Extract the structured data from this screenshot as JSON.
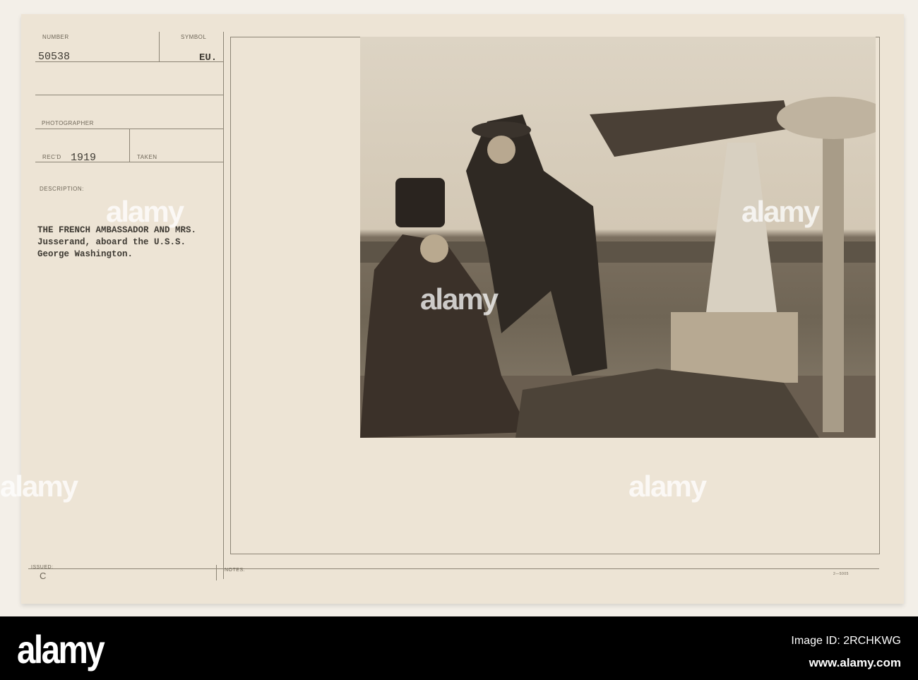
{
  "card": {
    "number_label": "NUMBER",
    "number": "50538",
    "symbol_label": "SYMBOL",
    "symbol": "EU.",
    "photographer_label": "PHOTOGRAPHER",
    "recd_label": "REC'D",
    "recd": "1919",
    "taken_label": "TAKEN",
    "description_label": "DESCRIPTION:",
    "description_lines": [
      "THE FRENCH AMBASSADOR AND MRS.",
      "Jusserand, aboard the U.S.S.",
      "George Washington."
    ],
    "issued_label": "ISSUED:",
    "issued": "C",
    "notes_label": "NOTES:",
    "form_code": "2—5005"
  },
  "watermark": "alamy",
  "footer": {
    "logo": "alamy",
    "image_id": "Image ID: 2RCHKWG",
    "url": "www.alamy.com"
  }
}
